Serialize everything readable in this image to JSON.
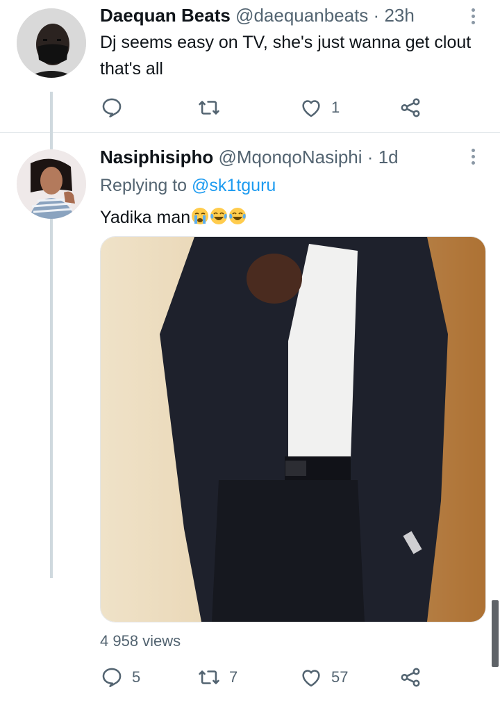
{
  "tweets": [
    {
      "display_name": "Daequan Beats",
      "handle": "@daequanbeats",
      "dot": "·",
      "time": "23h",
      "text": "Dj seems easy on TV, she's just wanna get clout that's all",
      "actions": {
        "reply_count": "",
        "retweet_count": "",
        "like_count": "1"
      }
    },
    {
      "display_name": "Nasiphisipho",
      "handle": "@MqonqoNasiphi",
      "dot": "·",
      "time": "1d",
      "replying_prefix": "Replying to",
      "replying_to": "@sk1tguru",
      "text": "Yadika man",
      "emojis": [
        "loudly-crying-face",
        "face-with-tears-of-joy",
        "face-with-tears-of-joy"
      ],
      "views": "4 958 views",
      "actions": {
        "reply_count": "5",
        "retweet_count": "7",
        "like_count": "57"
      }
    }
  ],
  "icons": {
    "reply": "reply-icon",
    "retweet": "retweet-icon",
    "like": "heart-icon",
    "share": "share-icon",
    "more": "more-dots-icon"
  },
  "colors": {
    "text": "#0f1419",
    "muted": "#536471",
    "link": "#1d9bf0",
    "thread_line": "#cfd9de",
    "divider": "#e1e6ea"
  }
}
